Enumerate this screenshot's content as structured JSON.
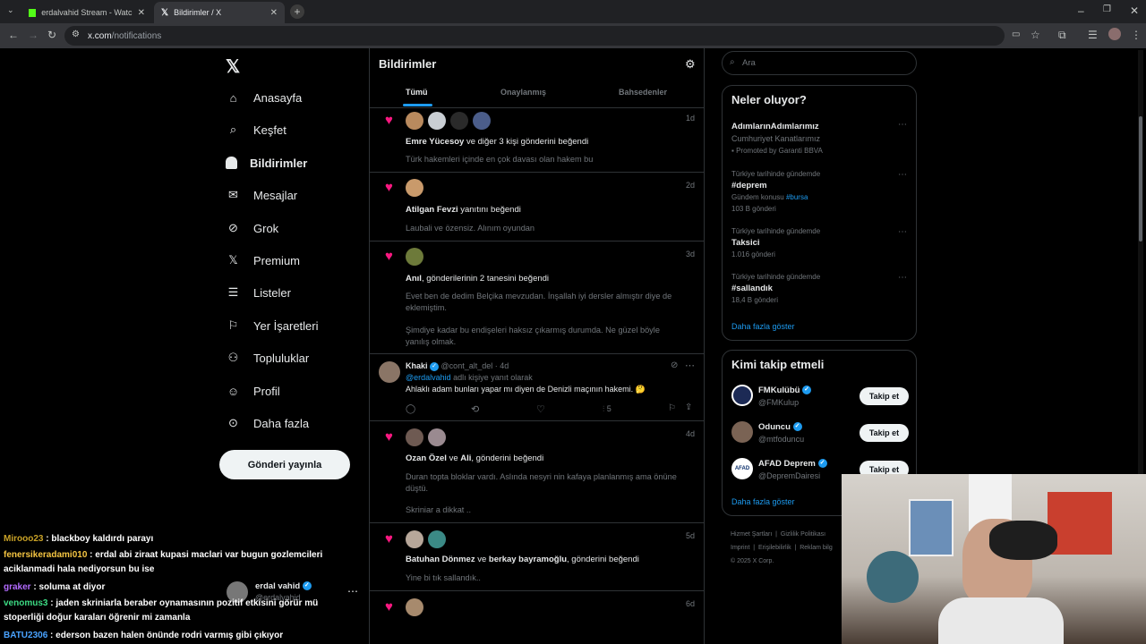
{
  "browser": {
    "tabs": [
      {
        "title": "erdalvahid Stream - Watch Live",
        "active": false
      },
      {
        "title": "Bildirimler / X",
        "active": true
      }
    ],
    "url_host": "x.com",
    "url_path": "/notifications"
  },
  "nav": {
    "items": [
      {
        "label": "Anasayfa",
        "icon": "home-icon"
      },
      {
        "label": "Keşfet",
        "icon": "search-icon"
      },
      {
        "label": "Bildirimler",
        "icon": "bell-icon"
      },
      {
        "label": "Mesajlar",
        "icon": "mail-icon"
      },
      {
        "label": "Grok",
        "icon": "grok-icon"
      },
      {
        "label": "Premium",
        "icon": "x-logo-icon"
      },
      {
        "label": "Listeler",
        "icon": "list-icon"
      },
      {
        "label": "Yer İşaretleri",
        "icon": "bookmark-icon"
      },
      {
        "label": "Topluluklar",
        "icon": "communities-icon"
      },
      {
        "label": "Profil",
        "icon": "profile-icon"
      },
      {
        "label": "Daha fazla",
        "icon": "more-icon"
      }
    ],
    "post_button": "Gönderi yayınla",
    "account_name": "erdal vahid",
    "account_handle": "@erdalvahid"
  },
  "center": {
    "title": "Bildirimler",
    "tabs": [
      "Tümü",
      "Onaylanmış",
      "Bahsedenler"
    ],
    "notifications": [
      {
        "bold": "Emre Yücesoy",
        "text": " ve diğer 3 kişi gönderini beğendi",
        "sub": [
          "Türk hakemleri içinde en çok davası olan hakem bu"
        ],
        "age": "1d"
      },
      {
        "bold": "Atilgan Fevzi",
        "text": " yanıtını beğendi",
        "sub": [
          "Laubali ve özensiz. Alınım oyundan"
        ],
        "age": "2d"
      },
      {
        "bold": "Anıl",
        "text": ", gönderilerinin 2 tanesini beğendi",
        "sub": [
          "Evet ben de dedim Belçika mevzudan. İnşallah iyi dersler almıştır diye de eklemiştim.",
          "Şimdiye kadar bu endişeleri haksız çıkarmış durumda. Ne güzel böyle yanılış olmak."
        ],
        "age": "3d"
      },
      {
        "bold": "Ozan Özel",
        "text": " ve ",
        "bold2": "Ali",
        "text2": ", gönderini beğendi",
        "sub": [
          "Duran topta bloklar vardı. Aslında nesyri nin kafaya planlanmış ama önüne düştü.",
          "Skriniar a dikkat .."
        ],
        "age": "4d"
      },
      {
        "bold": "Batuhan Dönmez",
        "text": " ve ",
        "bold2": "berkay bayramoğlu",
        "text2": ", gönderini beğendi",
        "sub": [
          "Yine bi tık sallandık.."
        ],
        "age": "5d"
      },
      {
        "bold": "",
        "text": "",
        "sub": [],
        "age": "6d"
      }
    ],
    "reply": {
      "name": "Khaki",
      "handle": "@cont_alt_del",
      "age": "4d",
      "reply_to_user": "@erdalvahid",
      "reply_to_text": " adlı kişiye yanıt olarak",
      "text": "Ahlaklı adam bunları yapar mı diyen de Denizli maçının hakemi. 🤔",
      "views": "5"
    }
  },
  "right": {
    "search_placeholder": "Ara",
    "trends_title": "Neler oluyor?",
    "trends": [
      {
        "context": "",
        "name": "AdımlarınAdımlarımız",
        "meta": "Cumhuriyet Kanatlarımız",
        "meta2": "Promoted by Garanti BBVA"
      },
      {
        "context": "Türkiye tarihinde gündemde",
        "name": "#deprem",
        "meta": "Gündem konusu",
        "meta_link": "#bursa",
        "meta2": "103 B gönderi"
      },
      {
        "context": "Türkiye tarihinde gündemde",
        "name": "Taksici",
        "meta2": "1.016 gönderi"
      },
      {
        "context": "Türkiye tarihinde gündemde",
        "name": "#sallandık",
        "meta2": "18,4 B gönderi"
      }
    ],
    "show_more": "Daha fazla göster",
    "follow_title": "Kimi takip etmeli",
    "follow": [
      {
        "name": "FMKulübü",
        "handle": "@FMKulup",
        "button": "Takip et"
      },
      {
        "name": "Oduncu",
        "handle": "@mtfoduncu",
        "button": "Takip et"
      },
      {
        "name": "AFAD Deprem",
        "handle": "@DepremDairesi",
        "button": "Takip et"
      }
    ],
    "follow_more": "Daha fazla göster",
    "footer": [
      "Hizmet Şartları",
      "Gizlilik Politikası",
      "Imprint",
      "Erişilebilirlik",
      "Reklam bilg"
    ],
    "copyright": "© 2025 X Corp."
  },
  "chat": [
    {
      "user": "Mirooo23",
      "color": "#c9a227",
      "msg": " : blackboy kaldırdı parayı"
    },
    {
      "user": "fenersikeradami010",
      "color": "#f5c542",
      "msg": " : erdal abi ziraat kupasi maclari var bugun gozlemcileri aciklanmadi hala nediyorsun bu ise"
    },
    {
      "user": "graker",
      "color": "#b36bff",
      "msg": " : soluma at diyor"
    },
    {
      "user": "venomus3",
      "color": "#3ddc84",
      "msg": " : jaden skriniarla beraber oynamasının pozitif etkisini görür mü stoperliği doğur karaları öğrenir mi zamanla"
    },
    {
      "user": "BATU2306",
      "color": "#4aa3ff",
      "msg": " : ederson bazen halen önünde rodri varmış gibi çıkıyor"
    }
  ]
}
